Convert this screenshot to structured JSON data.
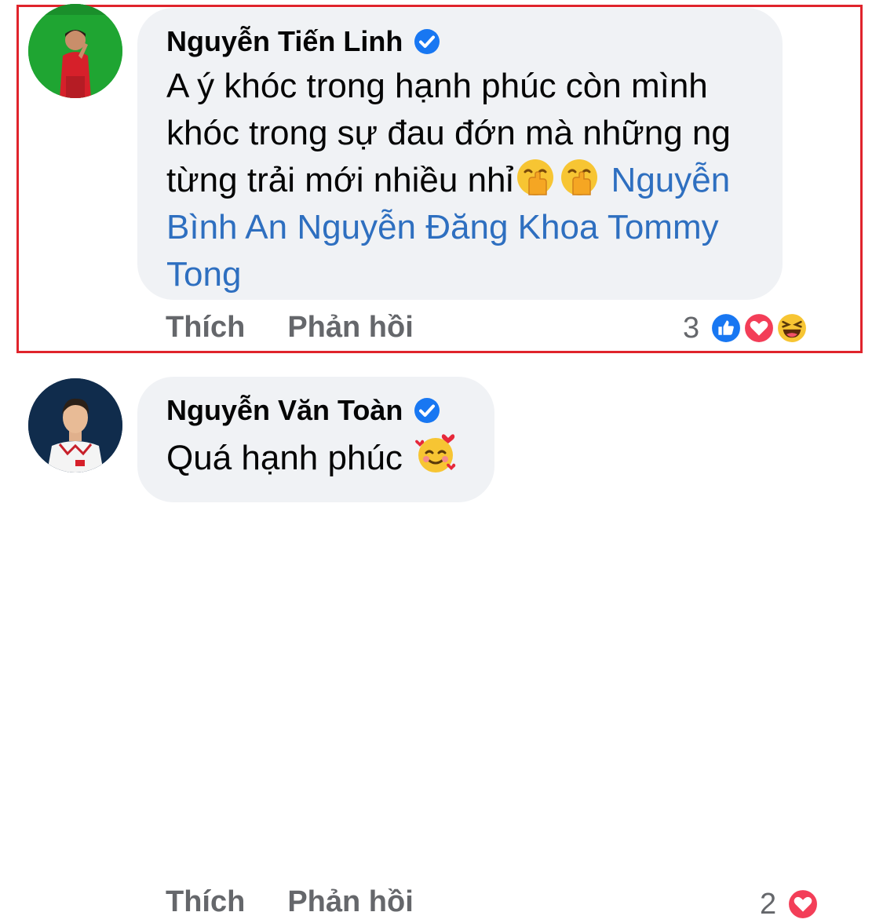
{
  "comments": [
    {
      "author": "Nguyễn Tiến Linh",
      "verified": true,
      "text_lines": [
        "A ý khóc trong hạnh phúc còn mình",
        "khóc trong sự đau đớn mà những ng",
        "từng trải mới nhiều nhỉ"
      ],
      "emojis": [
        "hand-over-mouth-emoji",
        "hand-over-mouth-emoji"
      ],
      "mentions": [
        "Nguyễn",
        "Bình An Nguyễn Đăng Khoa Tommy",
        "Tong"
      ],
      "actions": {
        "like": "Thích",
        "reply": "Phản hồi"
      },
      "reaction_count": "3",
      "reactions": [
        "like-reaction-icon",
        "love-reaction-icon",
        "haha-reaction-icon"
      ],
      "highlighted": true
    },
    {
      "author": "Nguyễn Văn Toàn",
      "verified": true,
      "text": "Quá hạnh phúc",
      "emojis": [
        "smiling-face-with-hearts-emoji"
      ],
      "actions": {
        "like": "Thích",
        "reply": "Phản hồi"
      },
      "reaction_count": "2",
      "reactions": [
        "love-reaction-icon"
      ]
    }
  ],
  "colors": {
    "bubble": "#f0f2f5",
    "mention": "#2e6fc0",
    "muted": "#65676b",
    "highlight_border": "#e0242c",
    "verified": "#1877f2"
  }
}
